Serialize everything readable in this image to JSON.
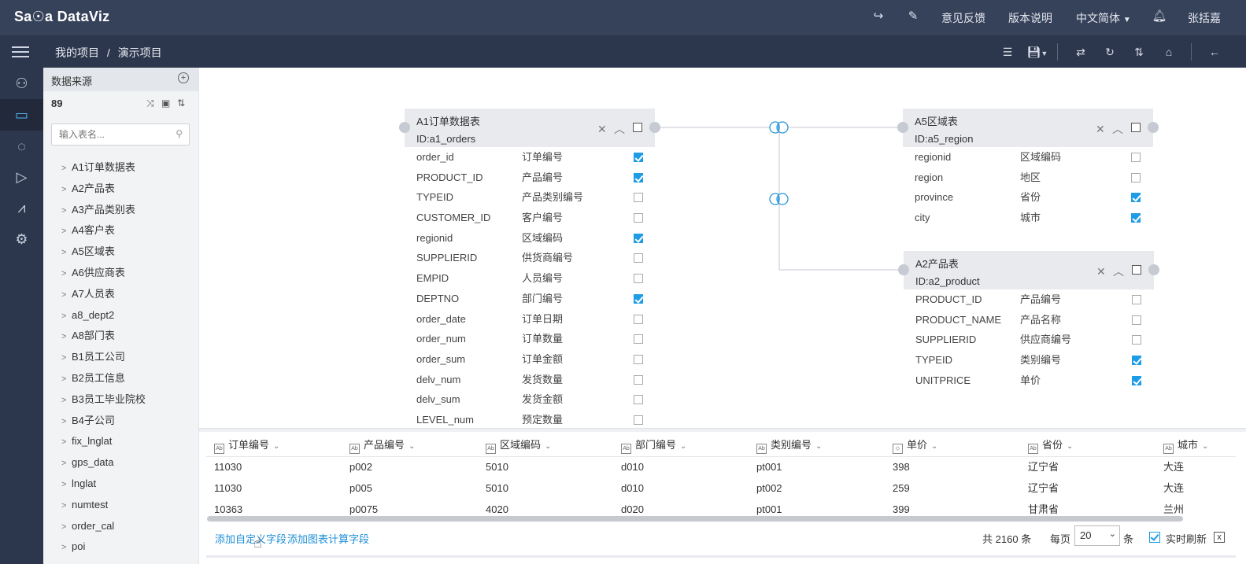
{
  "topbar": {
    "logo": "Sa☉a DataViz",
    "feedback": "意见反馈",
    "version": "版本说明",
    "language": "中文简体",
    "user": "张括嘉"
  },
  "breadcrumb": {
    "root": "我的项目",
    "sep": "/",
    "current": "演示项目"
  },
  "panel": {
    "title": "数据来源",
    "count": "89",
    "search_placeholder": "输入表名...",
    "tables": [
      "A1订单数据表",
      "A2产品表",
      "A3产品类别表",
      "A4客户表",
      "A5区域表",
      "A6供应商表",
      "A7人员表",
      "a8_dept2",
      "A8部门表",
      "B1员工公司",
      "B2员工信息",
      "B3员工毕业院校",
      "B4子公司",
      "fix_lnglat",
      "gps_data",
      "lnglat",
      "numtest",
      "order_cal",
      "poi"
    ]
  },
  "cards": {
    "orders": {
      "title": "A1订单数据表",
      "id": "ID:a1_orders",
      "fields": [
        {
          "name": "order_id",
          "cn": "订单编号",
          "checked": true
        },
        {
          "name": "PRODUCT_ID",
          "cn": "产品编号",
          "checked": true
        },
        {
          "name": "TYPEID",
          "cn": "产品类别编号",
          "checked": false
        },
        {
          "name": "CUSTOMER_ID",
          "cn": "客户编号",
          "checked": false
        },
        {
          "name": "regionid",
          "cn": "区域编码",
          "checked": true
        },
        {
          "name": "SUPPLIERID",
          "cn": "供货商编号",
          "checked": false
        },
        {
          "name": "EMPID",
          "cn": "人员编号",
          "checked": false
        },
        {
          "name": "DEPTNO",
          "cn": "部门编号",
          "checked": true
        },
        {
          "name": "order_date",
          "cn": "订单日期",
          "checked": false
        },
        {
          "name": "order_num",
          "cn": "订单数量",
          "checked": false
        },
        {
          "name": "order_sum",
          "cn": "订单金额",
          "checked": false
        },
        {
          "name": "delv_num",
          "cn": "发货数量",
          "checked": false
        },
        {
          "name": "delv_sum",
          "cn": "发货金额",
          "checked": false
        },
        {
          "name": "LEVEL_num",
          "cn": "预定数量",
          "checked": false
        }
      ]
    },
    "region": {
      "title": "A5区域表",
      "id": "ID:a5_region",
      "fields": [
        {
          "name": "regionid",
          "cn": "区域编码",
          "checked": false
        },
        {
          "name": "region",
          "cn": "地区",
          "checked": false
        },
        {
          "name": "province",
          "cn": "省份",
          "checked": true
        },
        {
          "name": "city",
          "cn": "城市",
          "checked": true
        }
      ]
    },
    "product": {
      "title": "A2产品表",
      "id": "ID:a2_product",
      "fields": [
        {
          "name": "PRODUCT_ID",
          "cn": "产品编号",
          "checked": false
        },
        {
          "name": "PRODUCT_NAME",
          "cn": "产品名称",
          "checked": false
        },
        {
          "name": "SUPPLIERID",
          "cn": "供应商编号",
          "checked": false
        },
        {
          "name": "TYPEID",
          "cn": "类别编号",
          "checked": true
        },
        {
          "name": "UNITPRICE",
          "cn": "单价",
          "checked": true
        }
      ]
    }
  },
  "grid": {
    "columns": [
      "订单编号",
      "产品编号",
      "区域编码",
      "部门编号",
      "类别编号",
      "单价",
      "省份",
      "城市"
    ],
    "rows": [
      [
        "11030",
        "p002",
        "5010",
        "d010",
        "pt001",
        "398",
        "辽宁省",
        "大连"
      ],
      [
        "11030",
        "p005",
        "5010",
        "d010",
        "pt002",
        "259",
        "辽宁省",
        "大连"
      ],
      [
        "10363",
        "p0075",
        "4020",
        "d020",
        "pt001",
        "399",
        "甘肃省",
        "兰州"
      ]
    ]
  },
  "footer": {
    "add_custom": "添加自定义字段",
    "add_calc": "添加图表计算字段",
    "total_prefix": "共",
    "total": "2160",
    "total_suffix": "条",
    "per_page": "每页",
    "page_size": "20",
    "page_unit": "条",
    "realtime": "实时刷新"
  }
}
